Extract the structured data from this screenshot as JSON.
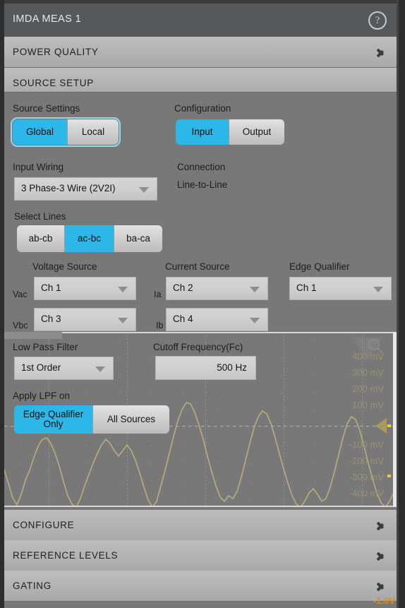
{
  "window": {
    "title": "IMDA MEAS 1",
    "help_icon": "question-mark-circle-icon"
  },
  "sections": [
    {
      "id": "power-quality",
      "label": "POWER QUALITY",
      "expanded": false
    },
    {
      "id": "source-setup",
      "label": "SOURCE SETUP",
      "expanded": true
    },
    {
      "id": "configure",
      "label": "CONFIGURE",
      "expanded": false
    },
    {
      "id": "reference-levels",
      "label": "REFERENCE LEVELS",
      "expanded": false
    },
    {
      "id": "gating",
      "label": "GATING",
      "expanded": false
    }
  ],
  "source_setup": {
    "source_settings": {
      "label": "Source Settings",
      "options": [
        "Global",
        "Local"
      ],
      "selected": "Global"
    },
    "configuration": {
      "label": "Configuration",
      "options": [
        "Input",
        "Output"
      ],
      "selected": "Input"
    },
    "input_wiring": {
      "label": "Input Wiring",
      "value": "3 Phase-3 Wire (2V2I)"
    },
    "connection": {
      "label": "Connection",
      "value": "Line-to-Line"
    },
    "select_lines": {
      "label": "Select Lines",
      "options": [
        "ab-cb",
        "ac-bc",
        "ba-ca"
      ],
      "selected": "ac-bc"
    },
    "columns": {
      "voltage_source": "Voltage Source",
      "current_source": "Current Source",
      "edge_qualifier": "Edge Qualifier"
    },
    "rows": [
      {
        "v_label": "Vac",
        "v_value": "Ch 1",
        "i_label": "Ia",
        "i_value": "Ch 2",
        "eq_value": "Ch 1"
      },
      {
        "v_label": "Vbc",
        "v_value": "Ch 3",
        "i_label": "Ib",
        "i_value": "Ch 4",
        "eq_value": ""
      }
    ]
  },
  "filter": {
    "low_pass_filter": {
      "label": "Low Pass Filter",
      "value": "1st Order"
    },
    "cutoff_frequency": {
      "label": "Cutoff Frequency(Fc)",
      "value": "500 Hz"
    },
    "apply_lpf_on": {
      "label": "Apply LPF on",
      "options": [
        "Edge Qualifier Only",
        "All Sources"
      ],
      "selected": "Edge Qualifier Only",
      "option_lines": [
        [
          "Edge Qualifier",
          "Only"
        ],
        [
          "All Sources"
        ]
      ]
    }
  },
  "scope": {
    "vertical_labels": [
      "400 mV",
      "300 mV",
      "200 mV",
      "100 mV",
      "-100 mV",
      "-200 mV",
      "-300 mV",
      "-400 mV"
    ],
    "bottom_value": "-1.0V",
    "trace_color": "#b5b07a",
    "cursor_color": "#e8d21f"
  },
  "colors": {
    "accent": "#2cb7e8",
    "panel_bg": "#787878",
    "header_bg": "#b2b2b2",
    "titlebar_bg": "#57585a"
  }
}
